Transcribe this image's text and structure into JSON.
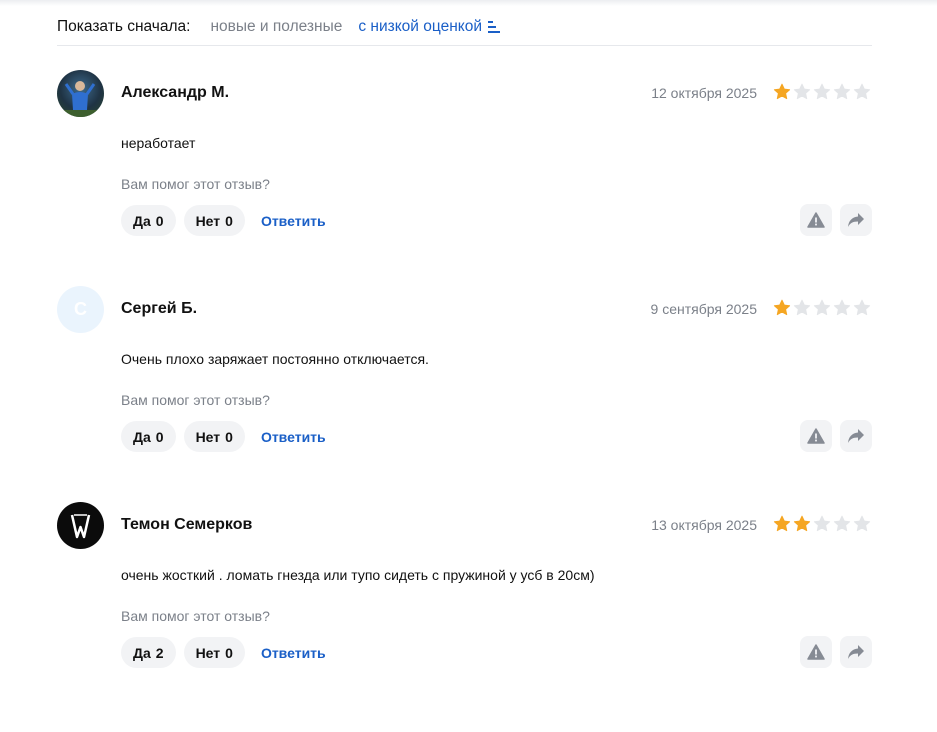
{
  "sort": {
    "label": "Показать сначала:",
    "options": [
      {
        "label": "новые и полезные",
        "active": false
      },
      {
        "label": "с низкой оценкой",
        "active": true
      }
    ]
  },
  "reviews": [
    {
      "author": "Александр М.",
      "avatar": {
        "type": "photo",
        "icon": "user-photo"
      },
      "date": "12 октября 2025",
      "rating": 1,
      "text": "неработает",
      "helpful_question": "Вам помог этот отзыв?",
      "yes_label": "Да",
      "yes_count": "0",
      "no_label": "Нет",
      "no_count": "0",
      "reply_label": "Ответить"
    },
    {
      "author": "Сергей Б.",
      "avatar": {
        "type": "letter",
        "letter": "С"
      },
      "date": "9 сентября 2025",
      "rating": 1,
      "text": "Очень плохо заряжает постоянно отключается.",
      "helpful_question": "Вам помог этот отзыв?",
      "yes_label": "Да",
      "yes_count": "0",
      "no_label": "Нет",
      "no_count": "0",
      "reply_label": "Ответить"
    },
    {
      "author": "Темон Семерков",
      "avatar": {
        "type": "logo",
        "icon": "monogram-logo"
      },
      "date": "13 октября 2025",
      "rating": 2,
      "text": "очень жосткий . ломать гнезда или тупо сидеть с пружиной у усб в 20см)",
      "helpful_question": "Вам помог этот отзыв?",
      "yes_label": "Да",
      "yes_count": "2",
      "no_label": "Нет",
      "no_count": "0",
      "reply_label": "Ответить"
    }
  ],
  "icons": {
    "report": "warning-triangle-icon",
    "share": "share-arrow-icon",
    "star": "star-icon"
  },
  "colors": {
    "accent": "#1a5fc7",
    "star_filled": "#f5a623",
    "star_empty": "#e3e5e8",
    "muted": "#7b8089"
  }
}
